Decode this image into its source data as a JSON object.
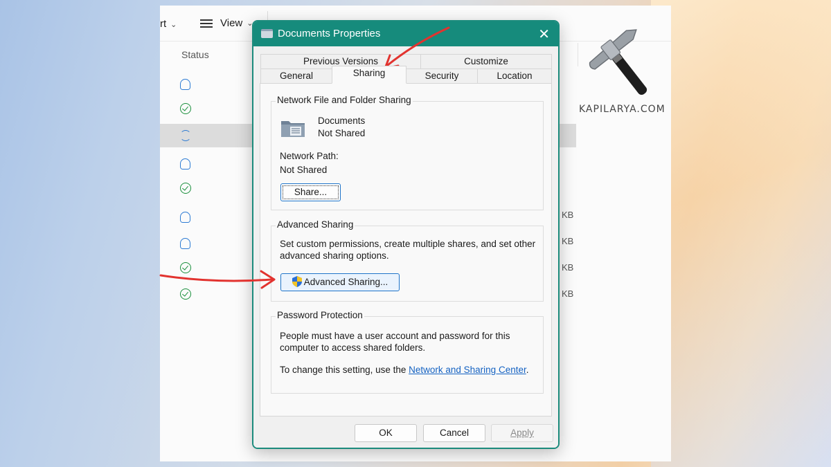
{
  "explorer": {
    "toolbar": {
      "sort_label": "rt",
      "view_label": "View"
    },
    "status_header": "Status",
    "rows": [
      {
        "status": "cloud-icon",
        "size": ""
      },
      {
        "status": "check-icon",
        "size": ""
      },
      {
        "status": "sync-icon",
        "size": "",
        "selected": true
      },
      {
        "status": "cloud-icon",
        "size": ""
      },
      {
        "status": "check-icon",
        "size": ""
      },
      {
        "status": "cloud-icon",
        "size": "KB"
      },
      {
        "status": "cloud-icon",
        "size": "KB"
      },
      {
        "status": "check-icon",
        "size": "KB"
      },
      {
        "status": "check-icon",
        "size": "KB"
      }
    ]
  },
  "logo": {
    "text": "KAPILARYA.COM"
  },
  "dialog": {
    "title": "Documents Properties",
    "tabs_top": [
      "Previous Versions",
      "Customize"
    ],
    "tabs_bottom": [
      "General",
      "Sharing",
      "Security",
      "Location"
    ],
    "active_tab": "Sharing",
    "network": {
      "title": "Network File and Folder Sharing",
      "folder_name": "Documents",
      "folder_state": "Not Shared",
      "path_label": "Network Path:",
      "path_value": "Not Shared",
      "share_button": "Share..."
    },
    "advanced": {
      "title": "Advanced Sharing",
      "description": "Set custom permissions, create multiple shares, and set other advanced sharing options.",
      "button": "Advanced Sharing..."
    },
    "password": {
      "title": "Password Protection",
      "description": "People must have a user account and password for this computer to access shared folders.",
      "change_prefix": "To change this setting, use the ",
      "link": "Network and Sharing Center",
      "change_suffix": "."
    },
    "footer": {
      "ok": "OK",
      "cancel": "Cancel",
      "apply": "Apply"
    }
  },
  "colors": {
    "titlebar": "#168b7c",
    "accent": "#1f74c9",
    "annotation": "#e2332f",
    "link": "#1462c2"
  }
}
